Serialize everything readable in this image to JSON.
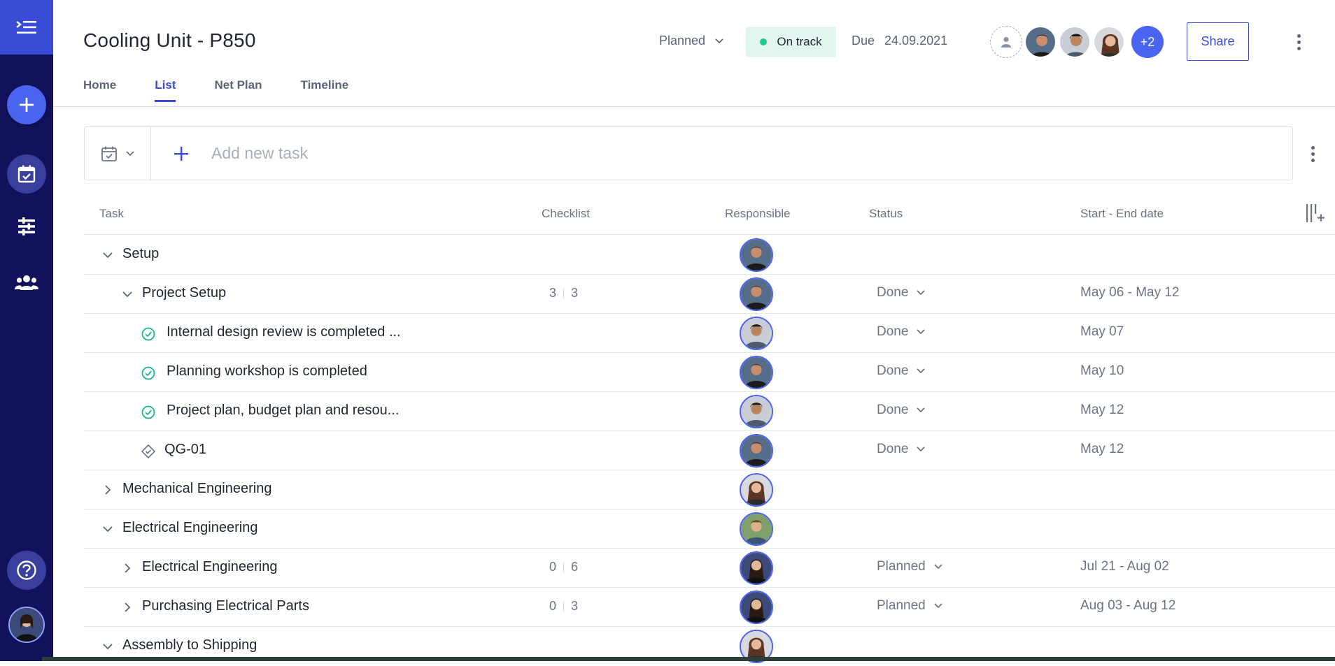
{
  "sidebar": {
    "menu_icon": "collapse-menu-icon",
    "add_icon": "plus-icon",
    "items": [
      {
        "icon": "calendar-check-icon",
        "active": true
      },
      {
        "icon": "sliders-icon",
        "active": false
      },
      {
        "icon": "team-icon",
        "active": false
      }
    ],
    "help_icon": "help-icon"
  },
  "header": {
    "title": "Cooling Unit - P850",
    "state": "Planned",
    "health": "On track",
    "health_color": "#1ecb8a",
    "due_label": "Due",
    "due_date": "24.09.2021",
    "more_members": "+2",
    "share_label": "Share",
    "tabs": [
      {
        "label": "Home",
        "active": false
      },
      {
        "label": "List",
        "active": true
      },
      {
        "label": "Net Plan",
        "active": false
      },
      {
        "label": "Timeline",
        "active": false
      }
    ]
  },
  "taskbar": {
    "placeholder": "Add new task"
  },
  "table": {
    "columns": {
      "task": "Task",
      "checklist": "Checklist",
      "responsible": "Responsible",
      "status": "Status",
      "dates": "Start - End date"
    },
    "rows": [
      {
        "name": "Setup",
        "level": 0,
        "expanded": true
      },
      {
        "name": "Project Setup",
        "level": 1,
        "expanded": true,
        "done": "3",
        "total": "3",
        "status": "Done",
        "dates": "May 06 - May 12"
      },
      {
        "name": "Internal design review is completed ...",
        "level": 2,
        "kind": "check",
        "status": "Done",
        "dates": "May 07"
      },
      {
        "name": "Planning workshop is completed",
        "level": 2,
        "kind": "check",
        "status": "Done",
        "dates": "May 10"
      },
      {
        "name": "Project plan, budget plan and resou...",
        "level": 2,
        "kind": "check",
        "status": "Done",
        "dates": "May 12"
      },
      {
        "name": "QG-01",
        "level": 2,
        "kind": "milestone",
        "status": "Done",
        "dates": "May 12"
      },
      {
        "name": "Mechanical Engineering",
        "level": 0,
        "expanded": false
      },
      {
        "name": "Electrical Engineering",
        "level": 0,
        "expanded": true
      },
      {
        "name": "Electrical Engineering",
        "level": 1,
        "expanded": false,
        "done": "0",
        "total": "6",
        "status": "Planned",
        "dates": "Jul 21 - Aug 02"
      },
      {
        "name": "Purchasing Electrical Parts",
        "level": 1,
        "expanded": false,
        "done": "0",
        "total": "3",
        "status": "Planned",
        "dates": "Aug 03 - Aug 12"
      },
      {
        "name": "Assembly to Shipping",
        "level": 0,
        "expanded": true
      }
    ]
  }
}
